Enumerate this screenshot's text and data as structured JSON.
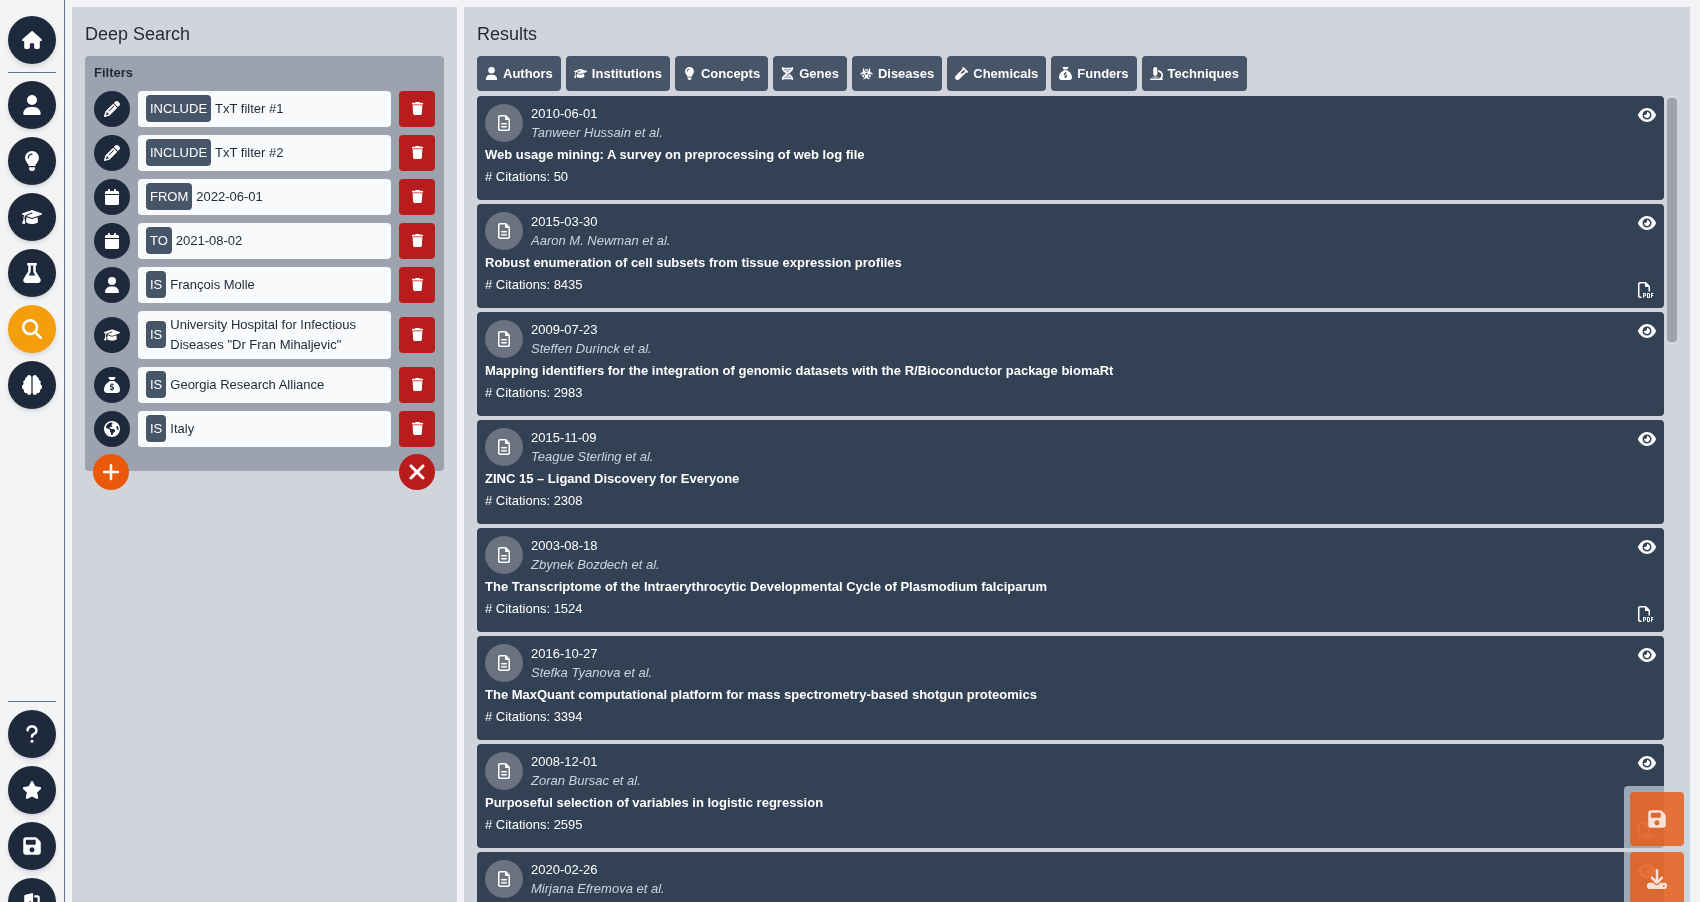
{
  "sidebar": {
    "items": [
      {
        "kind": "home",
        "selected": false
      },
      {
        "kind": "authors",
        "selected": false
      },
      {
        "kind": "concepts",
        "selected": false
      },
      {
        "kind": "institutions",
        "selected": false
      },
      {
        "kind": "lab",
        "selected": false
      },
      {
        "kind": "search",
        "selected": true
      },
      {
        "kind": "brain",
        "selected": false
      }
    ],
    "bottom_items": [
      {
        "kind": "help"
      },
      {
        "kind": "favorites"
      },
      {
        "kind": "save"
      },
      {
        "kind": "exit"
      }
    ]
  },
  "deep_search": {
    "title": "Deep Search",
    "filters_label": "Filters",
    "filters": [
      {
        "kind": "text",
        "operator": "INCLUDE",
        "value": "TxT filter #1"
      },
      {
        "kind": "text",
        "operator": "INCLUDE",
        "value": "TxT filter #2"
      },
      {
        "kind": "date",
        "operator": "FROM",
        "value": "2022-06-01"
      },
      {
        "kind": "date",
        "operator": "TO",
        "value": "2021-08-02"
      },
      {
        "kind": "author",
        "operator": "IS",
        "value": "François Molle"
      },
      {
        "kind": "institution",
        "operator": "IS",
        "value": "University Hospital for Infectious Diseases \"Dr Fran Mihaljevic\""
      },
      {
        "kind": "funder",
        "operator": "IS",
        "value": "Georgia Research Alliance"
      },
      {
        "kind": "country",
        "operator": "IS",
        "value": "Italy"
      }
    ]
  },
  "results": {
    "title": "Results",
    "tabs": [
      {
        "kind": "authors",
        "label": "Authors"
      },
      {
        "kind": "institutions",
        "label": "Institutions"
      },
      {
        "kind": "concepts",
        "label": "Concepts"
      },
      {
        "kind": "genes",
        "label": "Genes"
      },
      {
        "kind": "diseases",
        "label": "Diseases"
      },
      {
        "kind": "chemicals",
        "label": "Chemicals"
      },
      {
        "kind": "funders",
        "label": "Funders"
      },
      {
        "kind": "techniques",
        "label": "Techniques"
      }
    ],
    "items": [
      {
        "date": "2010-06-01",
        "authors": "Tanweer Hussain et al.",
        "title": "Web usage mining: A survey on preprocessing of web log file",
        "citations": "# Citations: 50",
        "has_pdf": false
      },
      {
        "date": "2015-03-30",
        "authors": "Aaron M. Newman et al.",
        "title": "Robust enumeration of cell subsets from tissue expression profiles",
        "citations": "# Citations: 8435",
        "has_pdf": true
      },
      {
        "date": "2009-07-23",
        "authors": "Steffen Durinck et al.",
        "title": "Mapping identifiers for the integration of genomic datasets with the R/Bioconductor package biomaRt",
        "citations": "# Citations: 2983",
        "has_pdf": false
      },
      {
        "date": "2015-11-09",
        "authors": "Teague Sterling et al.",
        "title": "ZINC 15 – Ligand Discovery for Everyone",
        "citations": "# Citations: 2308",
        "has_pdf": false
      },
      {
        "date": "2003-08-18",
        "authors": "Zbynek Bozdech et al.",
        "title": "The Transcriptome of the Intraerythrocytic Developmental Cycle of Plasmodium falciparum",
        "citations": "# Citations: 1524",
        "has_pdf": true
      },
      {
        "date": "2016-10-27",
        "authors": "Stefka Tyanova et al.",
        "title": "The MaxQuant computational platform for mass spectrometry-based shotgun proteomics",
        "citations": "# Citations: 3394",
        "has_pdf": false
      },
      {
        "date": "2008-12-01",
        "authors": "Zoran Bursac et al.",
        "title": "Purposeful selection of variables in logistic regression",
        "citations": "# Citations: 2595",
        "has_pdf": true
      },
      {
        "date": "2020-02-26",
        "authors": "Mirjana Efremova et al."
      }
    ]
  }
}
